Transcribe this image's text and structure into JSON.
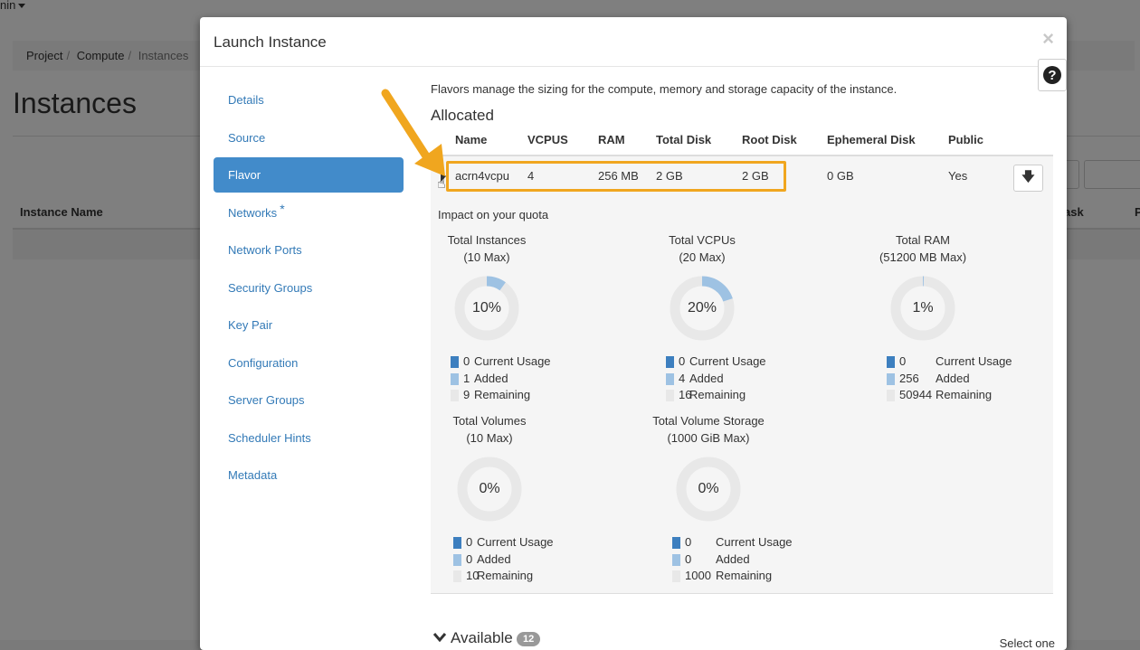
{
  "background": {
    "user_menu": "nin",
    "breadcrumb": [
      "Project",
      "Compute",
      "Instances"
    ],
    "page_title": "Instances",
    "table_headers": {
      "instance_name": "Instance Name",
      "task": "ask",
      "power": "P"
    }
  },
  "modal": {
    "title": "Launch Instance",
    "close_glyph": "×",
    "help_glyph": "?",
    "nav": [
      {
        "label": "Details"
      },
      {
        "label": "Source"
      },
      {
        "label": "Flavor",
        "active": true
      },
      {
        "label": "Networks",
        "required_mark": "*"
      },
      {
        "label": "Network Ports"
      },
      {
        "label": "Security Groups"
      },
      {
        "label": "Key Pair"
      },
      {
        "label": "Configuration"
      },
      {
        "label": "Server Groups"
      },
      {
        "label": "Scheduler Hints"
      },
      {
        "label": "Metadata"
      }
    ],
    "intro": "Flavors manage the sizing for the compute, memory and storage capacity of the instance.",
    "allocated_title": "Allocated",
    "columns": {
      "name": "Name",
      "vcpus": "VCPUS",
      "ram": "RAM",
      "total_disk": "Total Disk",
      "root_disk": "Root Disk",
      "ephemeral_disk": "Ephemeral Disk",
      "public": "Public"
    },
    "allocated_row": {
      "name": "acrn4vcpu",
      "vcpus": "4",
      "ram": "256 MB",
      "total_disk": "2 GB",
      "root_disk": "2 GB",
      "ephemeral_disk": "0 GB",
      "public": "Yes",
      "action_glyph": "🡇"
    },
    "quota": {
      "heading": "Impact on your quota",
      "legend_labels": {
        "used": "Current Usage",
        "added": "Added",
        "remaining": "Remaining"
      },
      "charts": [
        {
          "title": "Total Instances",
          "max": "(10 Max)",
          "percent": "10%",
          "fill": 0.1,
          "used": "0",
          "added": "1",
          "remaining": "9"
        },
        {
          "title": "Total VCPUs",
          "max": "(20 Max)",
          "percent": "20%",
          "fill": 0.2,
          "used": "0",
          "added": "4",
          "remaining": "16"
        },
        {
          "title": "Total RAM",
          "max": "(51200 MB Max)",
          "percent": "1%",
          "fill": 0.005,
          "used": "0",
          "added": "256",
          "remaining": "50944"
        },
        {
          "title": "Total Volumes",
          "max": "(10 Max)",
          "percent": "0%",
          "fill": 0,
          "used": "0",
          "added": "0",
          "remaining": "10"
        },
        {
          "title": "Total Volume Storage",
          "max": "(1000 GiB Max)",
          "percent": "0%",
          "fill": 0,
          "used": "0",
          "added": "0",
          "remaining": "1000"
        }
      ]
    },
    "available": {
      "title": "Available",
      "count": "12",
      "hint": "Select one"
    }
  },
  "colors": {
    "accent": "#428bca",
    "highlight": "#f0a61f",
    "used": "#3d7fbf",
    "added": "#9ec2e3",
    "remaining": "#e8e8e8"
  }
}
